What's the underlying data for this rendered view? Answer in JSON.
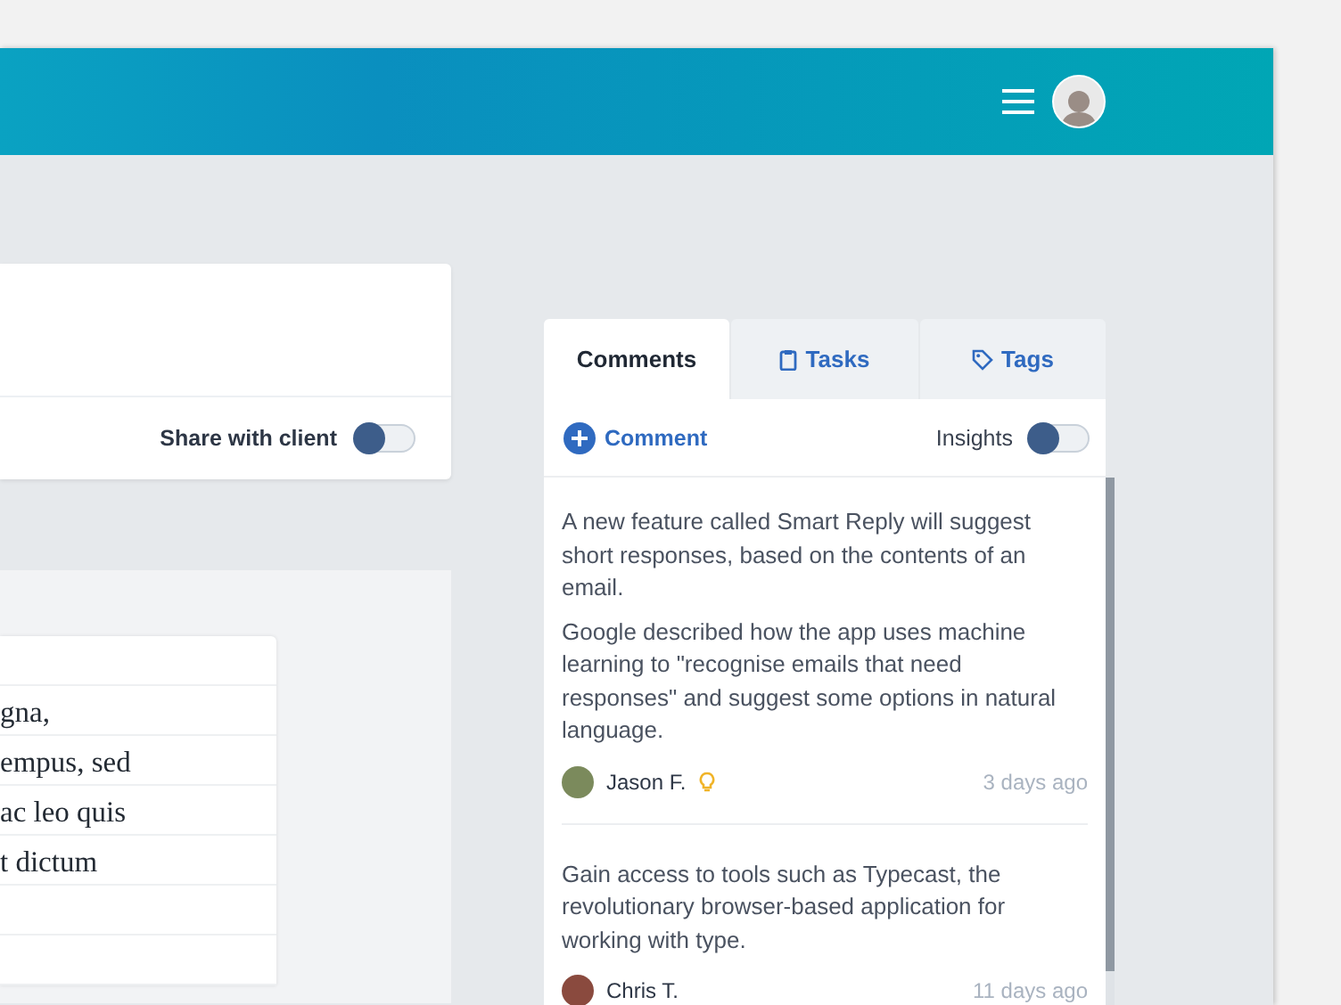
{
  "share_card": {
    "label": "Share with client",
    "on": false
  },
  "document": {
    "lines": [
      "gna,",
      "empus, sed",
      "ac leo quis",
      "t dictum"
    ]
  },
  "side_panel": {
    "tabs": [
      {
        "label": "Comments",
        "kind": "plain",
        "selected": true
      },
      {
        "label": "Tasks",
        "kind": "clipboard",
        "selected": false
      },
      {
        "label": "Tags",
        "kind": "tag",
        "selected": false
      }
    ],
    "add_button": "Comment",
    "insights": {
      "label": "Insights",
      "on": false
    },
    "comments": [
      {
        "paragraphs": [
          "A new feature called Smart Reply will suggest short responses, based on the contents of an email.",
          "Google described how the app uses machine learning to \"recognise emails that need responses\" and suggest some options in natural language."
        ],
        "author": "Jason F.",
        "insight": true,
        "time": "3 days ago"
      },
      {
        "paragraphs": [
          "Gain access to tools such as Typecast, the revolutionary browser-based application for working with type."
        ],
        "author": "Chris T.",
        "insight": false,
        "time": "11 days ago"
      }
    ]
  }
}
